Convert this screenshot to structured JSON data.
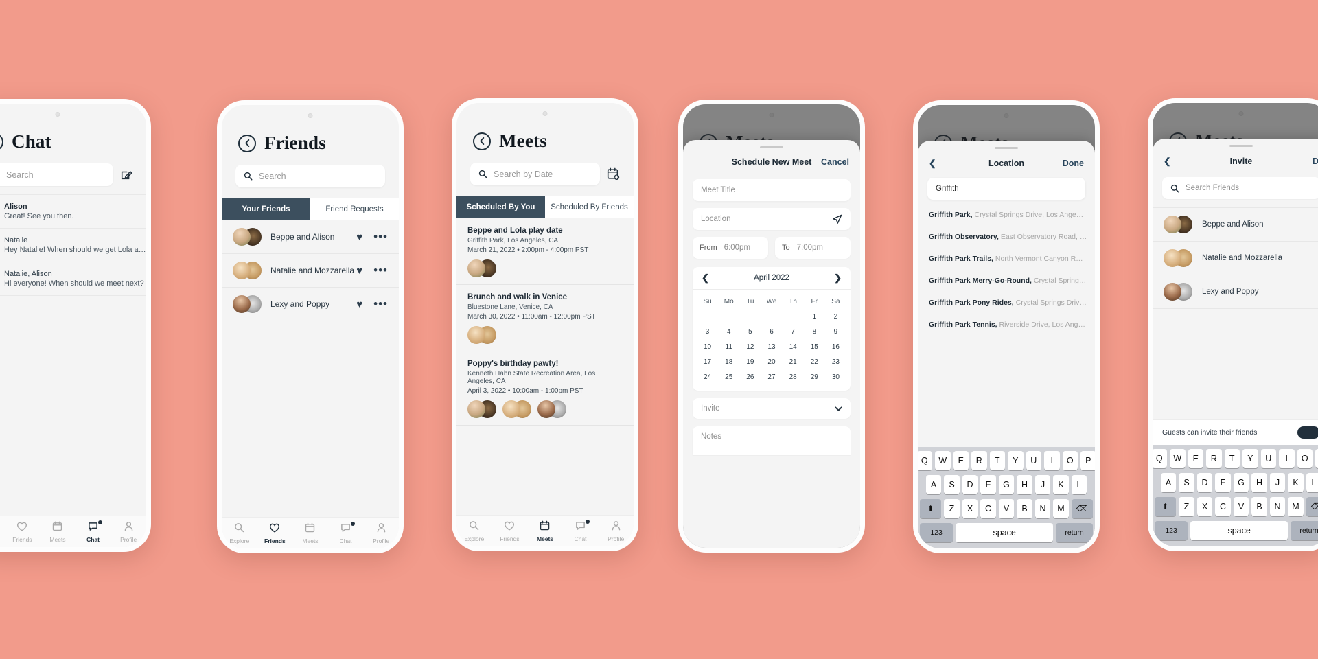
{
  "theme": {
    "background": "#f29b8b",
    "accent": "#3c4f5e",
    "dark": "#22303c",
    "card": "#ffffff"
  },
  "nav": {
    "items": [
      {
        "label": "Explore",
        "icon": "search-icon"
      },
      {
        "label": "Friends",
        "icon": "heart-icon"
      },
      {
        "label": "Meets",
        "icon": "calendar-icon"
      },
      {
        "label": "Chat",
        "icon": "chat-bubble-icon"
      },
      {
        "label": "Profile",
        "icon": "person-icon"
      }
    ]
  },
  "screen_chat": {
    "title": "Chat",
    "back_icon": "back-chevron-icon",
    "search_placeholder": "Search",
    "compose_icon": "compose-icon",
    "active_tab": "Chat",
    "conversations": [
      {
        "name": "Alison",
        "preview": "Great! See you then.",
        "bold_name": true
      },
      {
        "name": "Natalie",
        "preview": "Hey Natalie! When should we get Lola a…",
        "bold_name": false
      },
      {
        "name": "Natalie, Alison",
        "preview": "Hi everyone! When should we meet next?",
        "bold_name": false
      }
    ]
  },
  "screen_friends": {
    "title": "Friends",
    "search_placeholder": "Search",
    "active_tab": "Friends",
    "tabs": [
      {
        "label": "Your Friends",
        "active": true
      },
      {
        "label": "Friend Requests",
        "active": false
      }
    ],
    "rows": [
      {
        "name": "Beppe and Alison",
        "favorite_icon": "heart-filled-icon",
        "more_icon": "more-dots-icon"
      },
      {
        "name": "Natalie and Mozzarella",
        "favorite_icon": "heart-filled-icon",
        "more_icon": "more-dots-icon"
      },
      {
        "name": "Lexy and Poppy",
        "favorite_icon": "heart-filled-icon",
        "more_icon": "more-dots-icon"
      }
    ]
  },
  "screen_meets": {
    "title": "Meets",
    "search_placeholder": "Search by Date",
    "add_icon": "calendar-add-icon",
    "active_tab": "Meets",
    "tabs": [
      {
        "label": "Scheduled By You",
        "active": true
      },
      {
        "label": "Scheduled By Friends",
        "active": false
      }
    ],
    "cards": [
      {
        "title": "Beppe and Lola play date",
        "location": "Griffith Park, Los Angeles, CA",
        "when": "March 21, 2022  •  2:00pm - 4:00pm PST",
        "attendees": 1
      },
      {
        "title": "Brunch and walk in Venice",
        "location": "Bluestone Lane, Venice, CA",
        "when": "March 30, 2022  •  11:00am - 12:00pm PST",
        "attendees": 1
      },
      {
        "title": "Poppy's birthday pawty!",
        "location": "Kenneth Hahn State Recreation Area, Los Angeles, CA",
        "when": "April 3, 2022  •  10:00am - 1:00pm PST",
        "attendees": 3
      }
    ]
  },
  "screen_schedule": {
    "behind_title": "Meets",
    "sheet_title": "Schedule New Meet",
    "cancel_label": "Cancel",
    "title_placeholder": "Meet Title",
    "location_placeholder": "Location",
    "location_icon": "navigate-arrow-icon",
    "from_label": "From",
    "from_value": "6:00pm",
    "to_label": "To",
    "to_value": "7:00pm",
    "invite_placeholder": "Invite",
    "chevron_icon": "chevron-down-icon",
    "notes_placeholder": "Notes",
    "calendar": {
      "month": "April 2022",
      "prev_icon": "chevron-left-icon",
      "next_icon": "chevron-right-icon",
      "dow": [
        "Su",
        "Mo",
        "Tu",
        "We",
        "Th",
        "Fr",
        "Sa"
      ],
      "leading_blanks": 5,
      "days": [
        1,
        2,
        3,
        4,
        5,
        6,
        7,
        8,
        9,
        10,
        11,
        12,
        13,
        14,
        15,
        16,
        17,
        18,
        19,
        20,
        21,
        22,
        23,
        24,
        25,
        26,
        27,
        28,
        29,
        30
      ]
    }
  },
  "screen_location": {
    "behind_title": "Meets",
    "sheet_title": "Location",
    "back_icon": "chevron-left-icon",
    "done_label": "Done",
    "query": "Griffith",
    "results": [
      {
        "name": "Griffith Park,",
        "address": " Crystal Springs Drive, Los Ange…"
      },
      {
        "name": "Griffith Observatory,",
        "address": " East Observatory Road, …"
      },
      {
        "name": "Griffith Park Trails,",
        "address": " North Vermont Canyon R…"
      },
      {
        "name": "Griffith Park Merry-Go-Round,",
        "address": " Crystal Spring…"
      },
      {
        "name": "Griffith Park Pony Rides,",
        "address": " Crystal Springs Driv…"
      },
      {
        "name": "Griffith Park Tennis,",
        "address": " Riverside Drive, Los Ang…"
      }
    ]
  },
  "screen_invite": {
    "behind_title": "Meets",
    "sheet_title": "Invite",
    "back_icon": "chevron-left-icon",
    "done_label": "D",
    "search_placeholder": "Search Friends",
    "friends": [
      {
        "name": "Beppe and Alison"
      },
      {
        "name": "Natalie and Mozzarella"
      },
      {
        "name": "Lexy and Poppy"
      }
    ],
    "toggle_label": "Guests can invite their friends",
    "toggle_on": true
  },
  "keyboard": {
    "row1": [
      "Q",
      "W",
      "E",
      "R",
      "T",
      "Y",
      "U",
      "I",
      "O",
      "P"
    ],
    "row2": [
      "A",
      "S",
      "D",
      "F",
      "G",
      "H",
      "J",
      "K",
      "L"
    ],
    "row3": [
      "Z",
      "X",
      "C",
      "V",
      "B",
      "N",
      "M"
    ],
    "shift_icon": "shift-arrow-icon",
    "backspace_icon": "backspace-icon",
    "num_label": "123",
    "space_label": "space",
    "return_label": "return"
  }
}
